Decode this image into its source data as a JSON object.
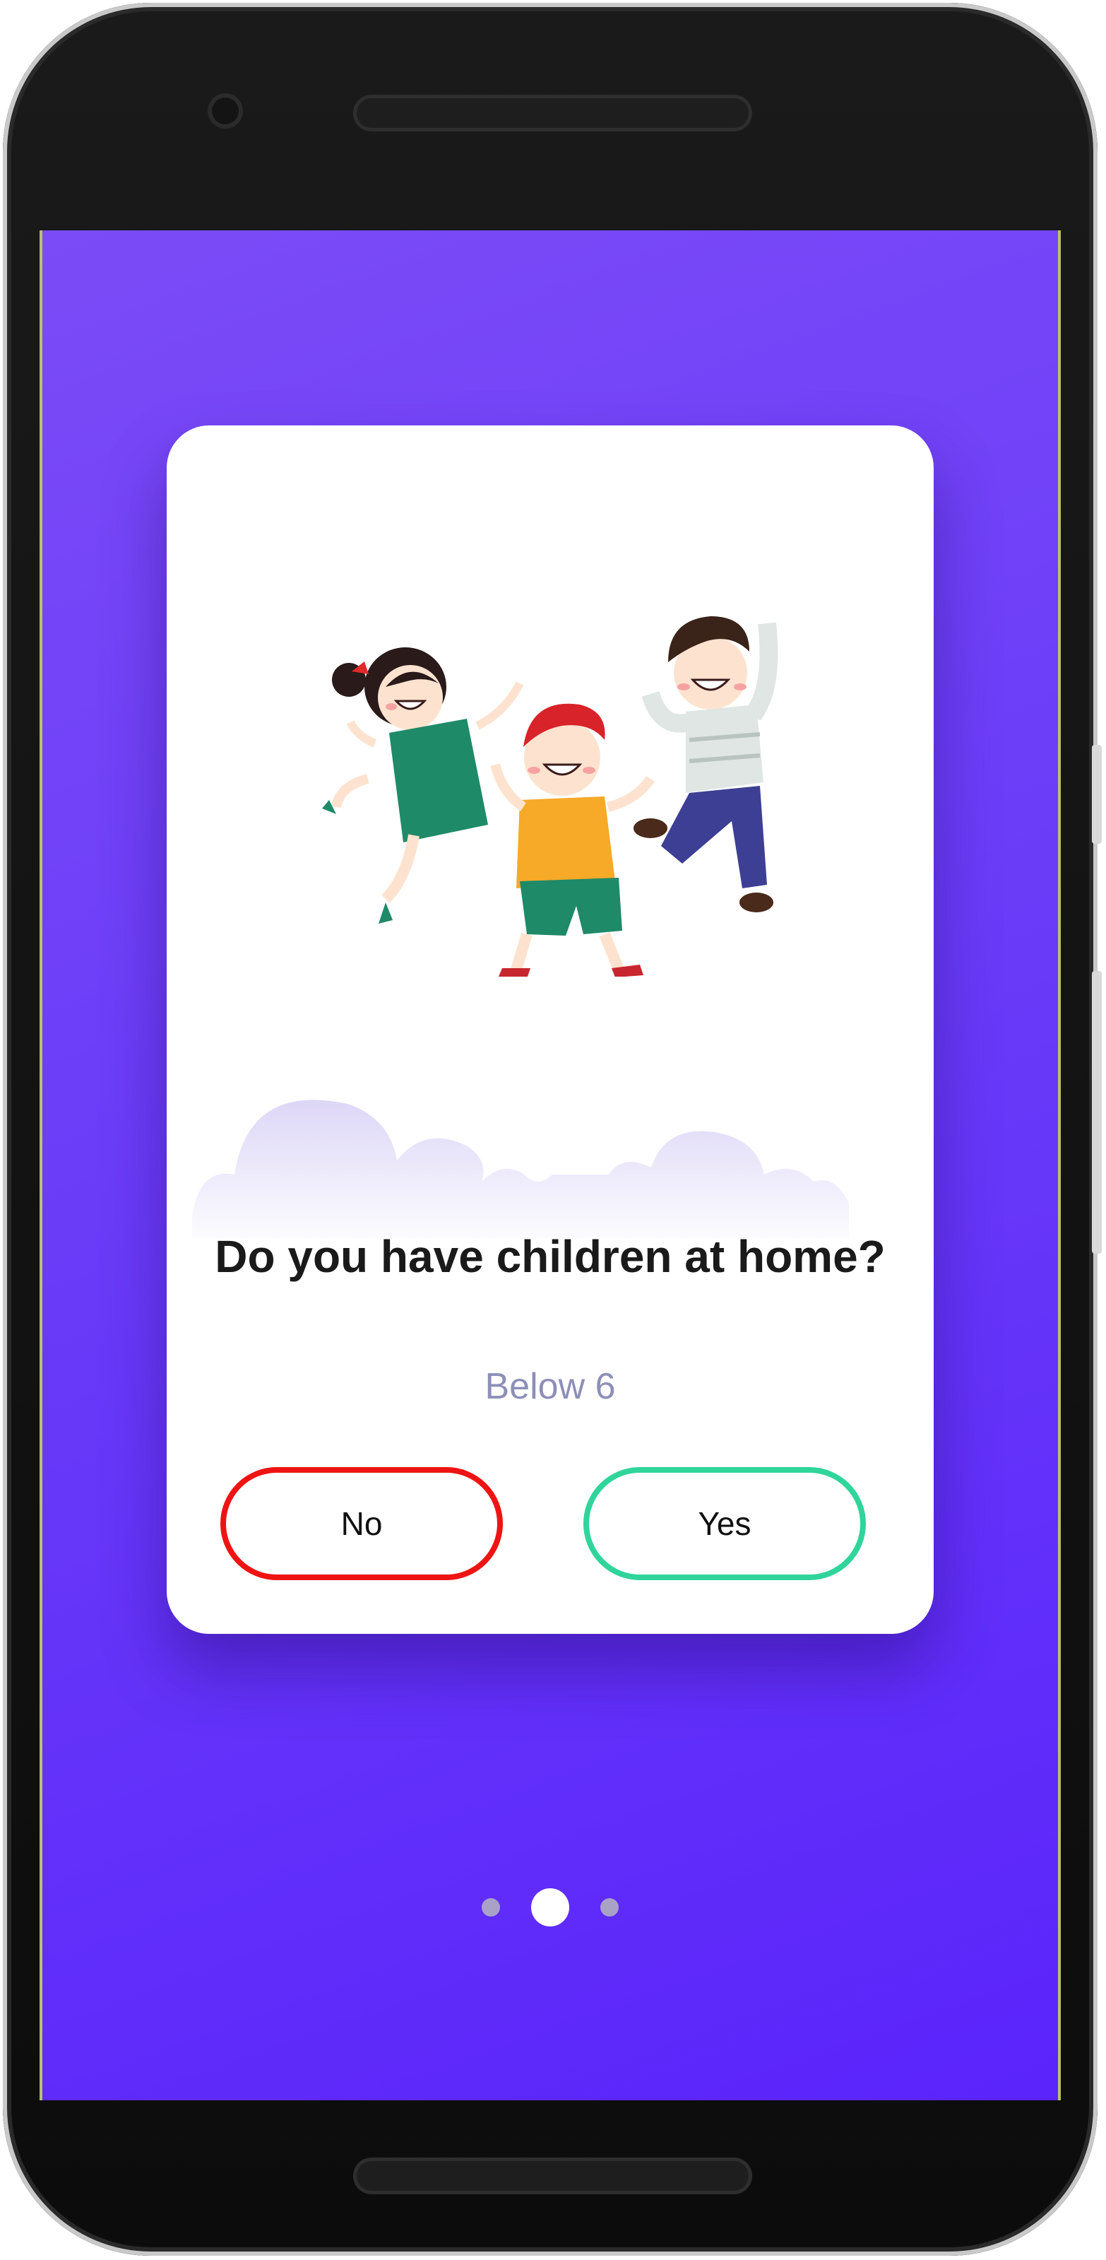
{
  "question": {
    "title": "Do you have children at home?",
    "subtitle": "Below 6"
  },
  "buttons": {
    "no_label": "No",
    "yes_label": "Yes"
  },
  "pagination": {
    "total": 3,
    "active_index": 1
  },
  "colors": {
    "background_top": "#7b4bf7",
    "background_bottom": "#5a24fb",
    "no_border": "#ee1414",
    "yes_border": "#2fd59a",
    "subtitle": "#8d8fb8"
  },
  "icons": {
    "illustration": "children-jumping-illustration",
    "cloud": "cloud-decoration"
  }
}
